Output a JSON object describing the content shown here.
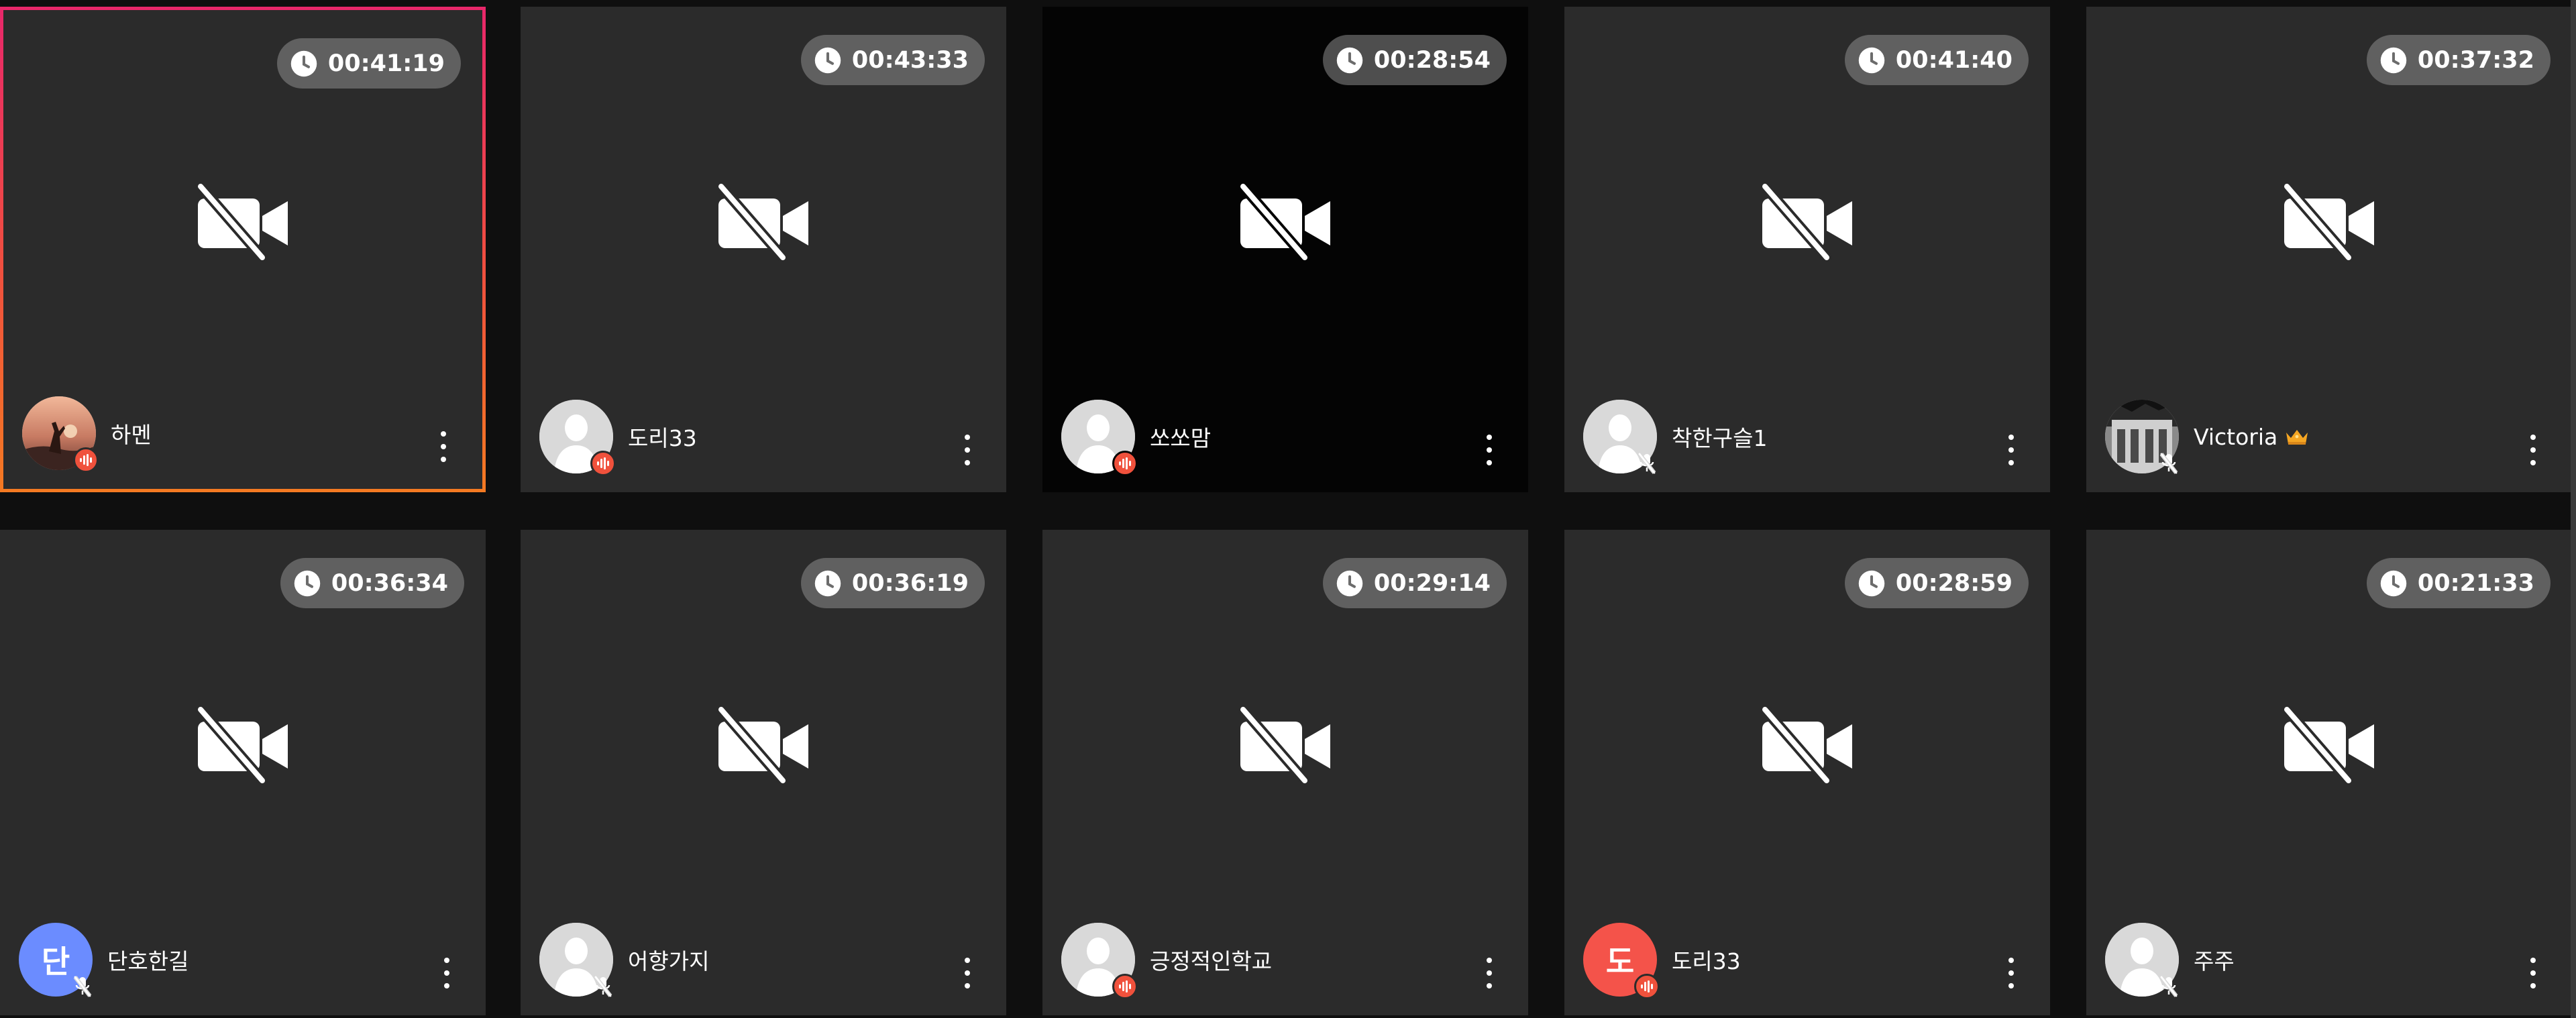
{
  "participants": [
    {
      "name": "하멘",
      "timer": "00:41:19",
      "avatar_type": "photo-sunset",
      "mic": "speaking",
      "active": true,
      "dark_video": false,
      "crown": false
    },
    {
      "name": "도리33",
      "timer": "00:43:33",
      "avatar_type": "default",
      "mic": "speaking",
      "active": false,
      "dark_video": false,
      "crown": false
    },
    {
      "name": "쏘쏘맘",
      "timer": "00:28:54",
      "avatar_type": "default",
      "mic": "speaking",
      "active": false,
      "dark_video": true,
      "crown": false
    },
    {
      "name": "착한구슬1",
      "timer": "00:41:40",
      "avatar_type": "default",
      "mic": "muted",
      "active": false,
      "dark_video": false,
      "crown": false
    },
    {
      "name": "Victoria",
      "timer": "00:37:32",
      "avatar_type": "photo-building",
      "mic": "muted",
      "active": false,
      "dark_video": false,
      "crown": true
    },
    {
      "name": "단호한길",
      "timer": "00:36:34",
      "avatar_type": "letter",
      "avatar_letter": "단",
      "avatar_color": "#6b8cff",
      "mic": "muted",
      "active": false,
      "dark_video": false,
      "crown": false
    },
    {
      "name": "어향가지",
      "timer": "00:36:19",
      "avatar_type": "default",
      "mic": "muted",
      "active": false,
      "dark_video": false,
      "crown": false
    },
    {
      "name": "긍정적인학교",
      "timer": "00:29:14",
      "avatar_type": "default",
      "mic": "speaking",
      "active": false,
      "dark_video": false,
      "crown": false
    },
    {
      "name": "도리33",
      "timer": "00:28:59",
      "avatar_type": "letter",
      "avatar_letter": "도",
      "avatar_color": "#f4534a",
      "mic": "speaking",
      "active": false,
      "dark_video": false,
      "crown": false
    },
    {
      "name": "주주",
      "timer": "00:21:33",
      "avatar_type": "default",
      "mic": "muted",
      "active": false,
      "dark_video": false,
      "crown": false
    }
  ],
  "icons": {
    "timer": "clock-icon",
    "video_off": "video-off-icon",
    "mic_on": "mic-speaking-icon",
    "mic_off": "mic-off-icon",
    "host": "crown-icon",
    "menu": "more-vert-icon"
  },
  "colors": {
    "tile_bg": "#2b2b2b",
    "page_bg": "#0f0f0f",
    "speaking": "#f0513c",
    "active_border_top": "#e8276a",
    "active_border_bottom": "#f47a22",
    "crown": "#f5a623"
  }
}
